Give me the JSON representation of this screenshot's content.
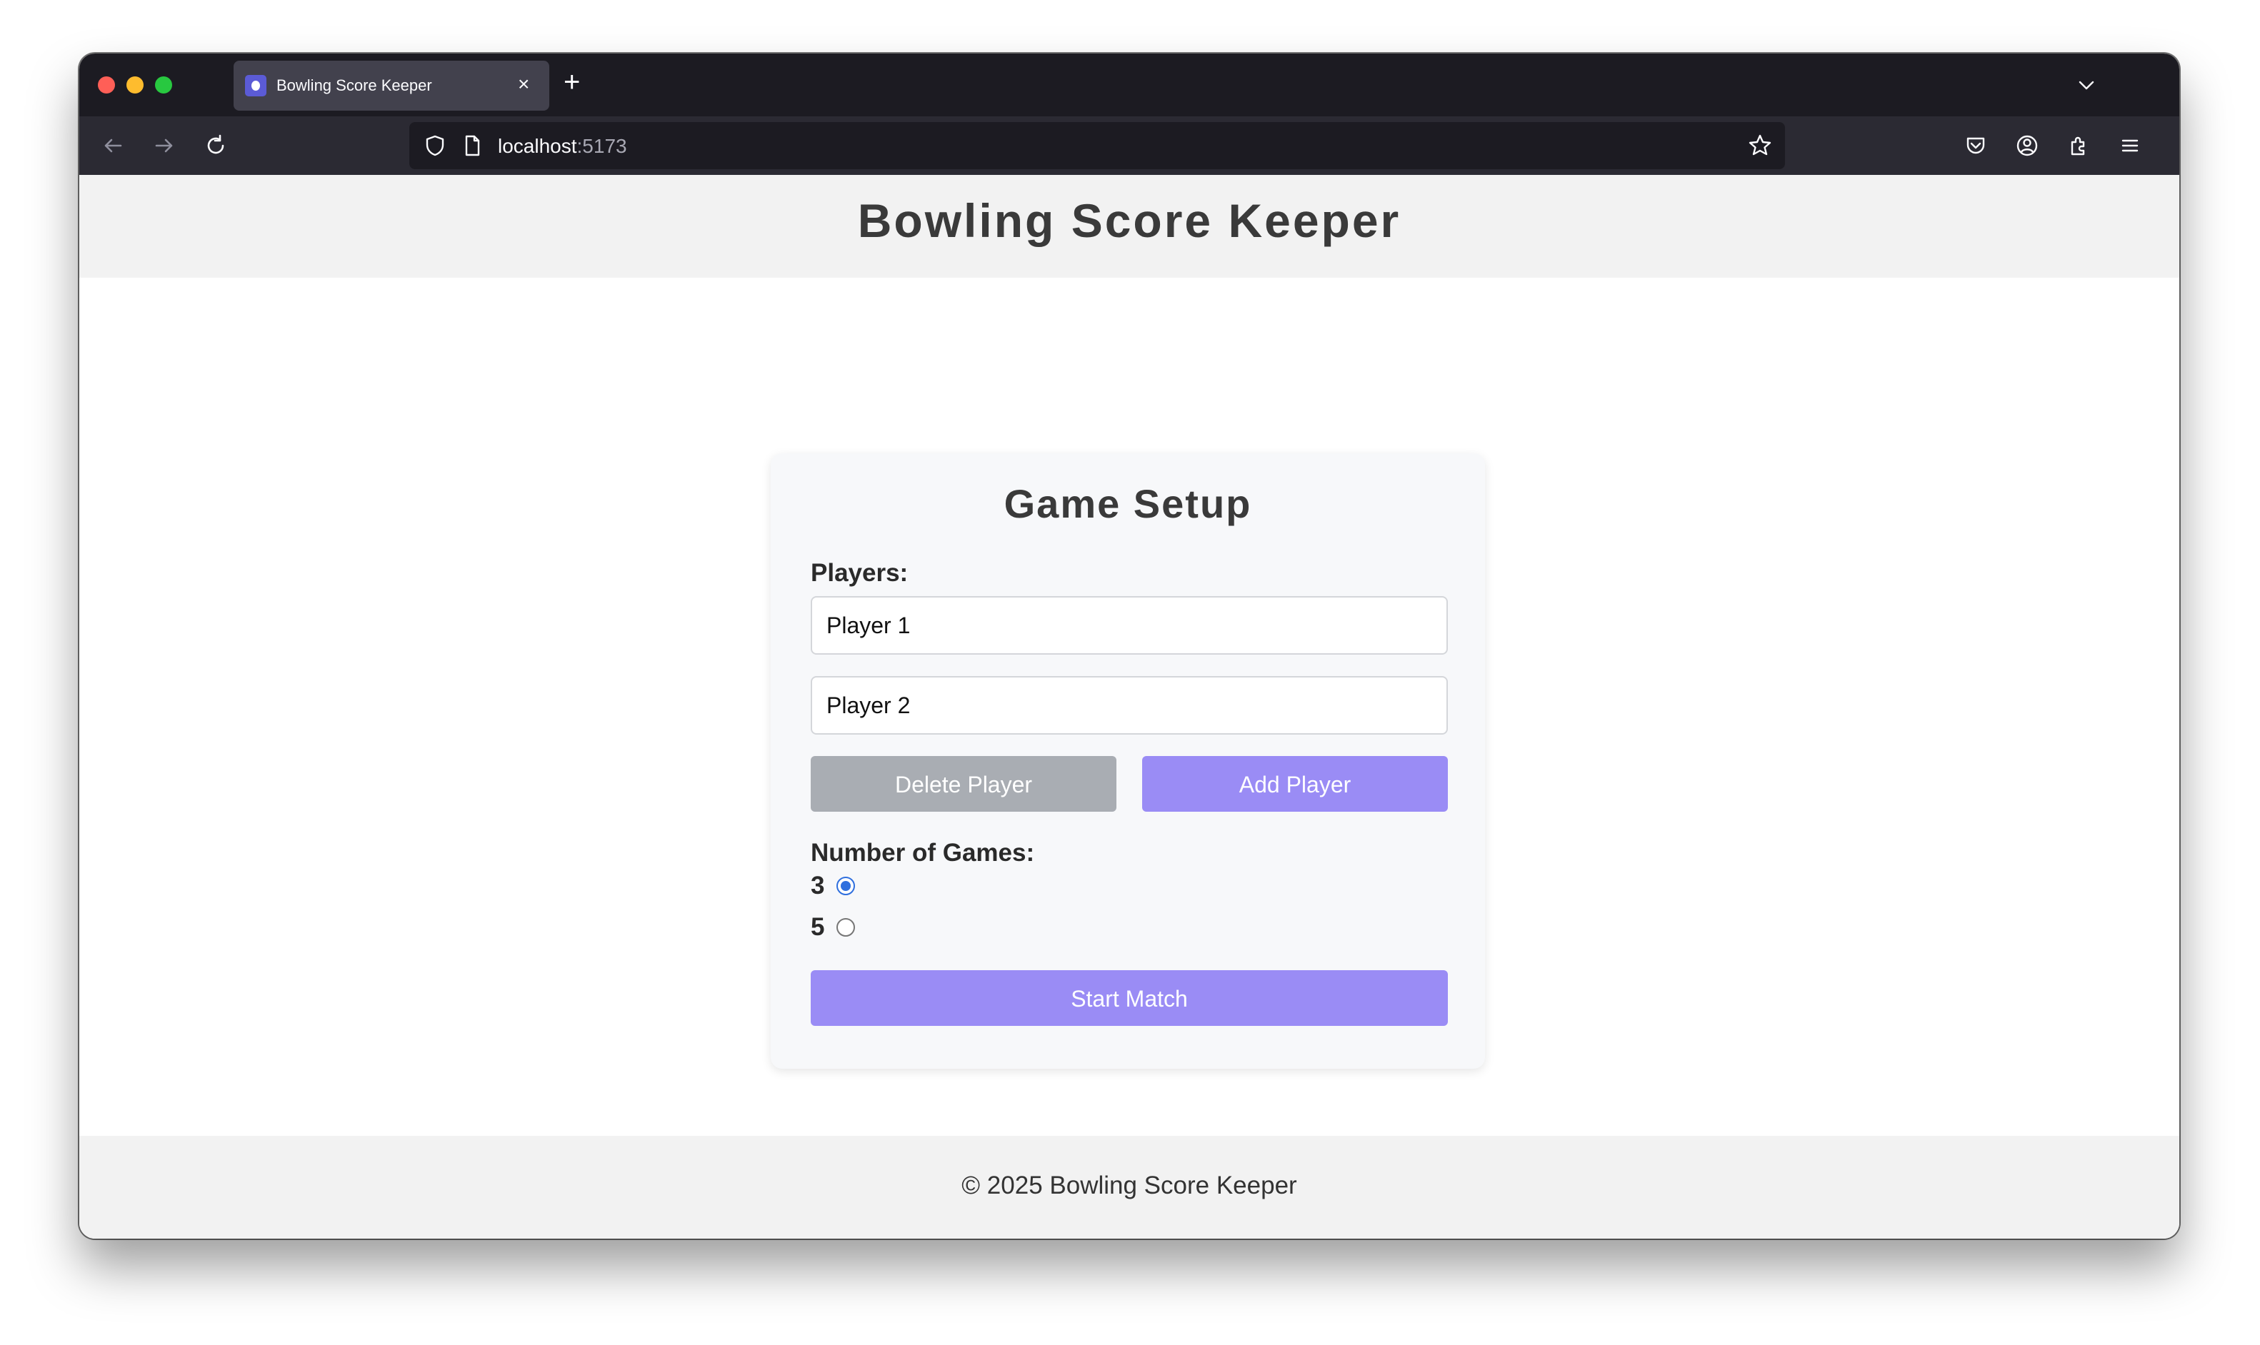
{
  "browser": {
    "tab_title": "Bowling Score Keeper",
    "tab_close_icon": "×",
    "new_tab_icon": "+",
    "url_host": "localhost",
    "url_port": ":5173"
  },
  "header": {
    "title": "Bowling Score Keeper"
  },
  "setup": {
    "title": "Game Setup",
    "players_label": "Players:",
    "players": [
      "Player 1",
      "Player 2"
    ],
    "delete_button": "Delete Player",
    "add_button": "Add Player",
    "games_label": "Number of Games:",
    "game_options": [
      "3",
      "5"
    ],
    "selected_games": "3",
    "start_button": "Start Match"
  },
  "footer": {
    "text": "© 2025 Bowling Score Keeper"
  },
  "colors": {
    "accent": "#9a8cf5",
    "disabled": "#a9adb3",
    "radio_selected": "#2f6fde"
  },
  "icons": {
    "tab_favicon": "bowling-favicon-icon",
    "back": "back-arrow-icon",
    "forward": "forward-arrow-icon",
    "reload": "reload-icon",
    "shield": "shield-icon",
    "page": "page-icon",
    "bookmark": "star-icon",
    "pocket": "pocket-icon",
    "account": "account-icon",
    "extensions": "extensions-icon",
    "menu": "hamburger-menu-icon",
    "tab_list": "chevron-down-icon"
  }
}
